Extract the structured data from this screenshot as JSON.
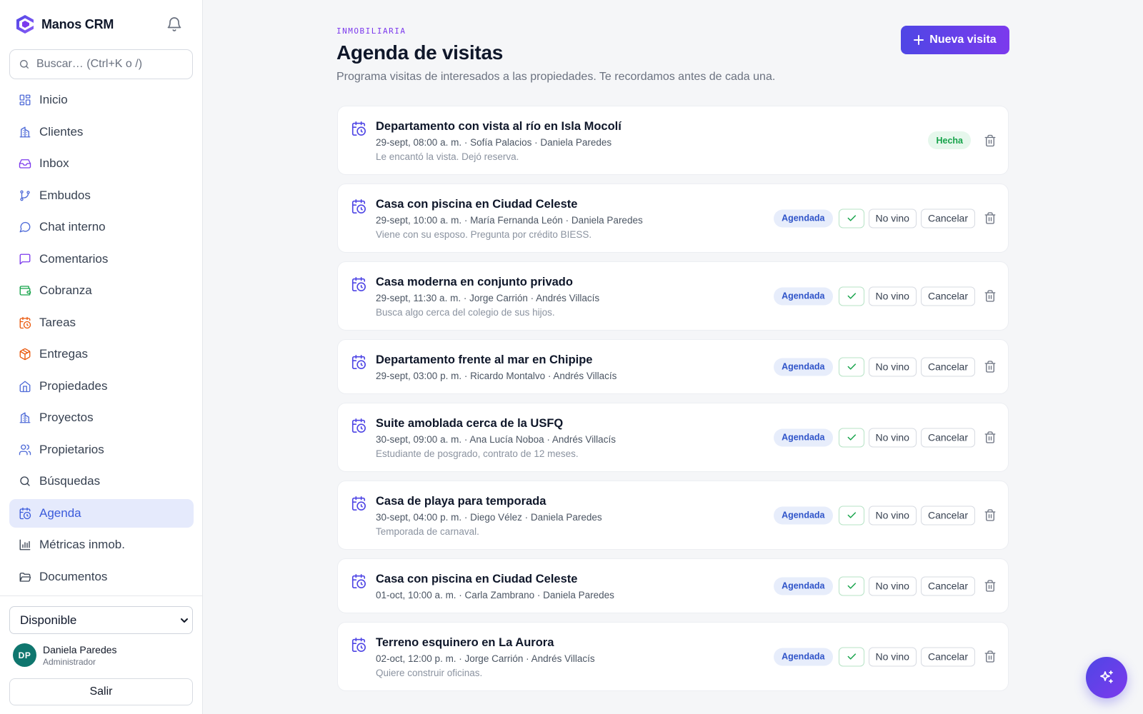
{
  "app": {
    "name": "Manos CRM"
  },
  "search": {
    "placeholder": "Buscar… (Ctrl+K o /)"
  },
  "sidebar": {
    "items": [
      {
        "label": "Inicio",
        "icon": "grid-icon",
        "color": "#4f6bd8"
      },
      {
        "label": "Clientes",
        "icon": "building-icon",
        "color": "#4f6bd8"
      },
      {
        "label": "Inbox",
        "icon": "inbox-icon",
        "color": "#7c3aed"
      },
      {
        "label": "Embudos",
        "icon": "git-branch-icon",
        "color": "#4f6bd8"
      },
      {
        "label": "Chat interno",
        "icon": "chat-bubble-icon",
        "color": "#4f6bd8"
      },
      {
        "label": "Comentarios",
        "icon": "comment-icon",
        "color": "#7c3aed"
      },
      {
        "label": "Cobranza",
        "icon": "wallet-icon",
        "color": "#16a34a"
      },
      {
        "label": "Tareas",
        "icon": "calendar-clock-icon",
        "color": "#ea580c"
      },
      {
        "label": "Entregas",
        "icon": "package-icon",
        "color": "#ea580c"
      },
      {
        "label": "Propiedades",
        "icon": "home-icon",
        "color": "#4f6bd8"
      },
      {
        "label": "Proyectos",
        "icon": "building-icon",
        "color": "#4f6bd8"
      },
      {
        "label": "Propietarios",
        "icon": "users-icon",
        "color": "#4f6bd8"
      },
      {
        "label": "Búsquedas",
        "icon": "search-icon",
        "color": "#374151"
      },
      {
        "label": "Agenda",
        "icon": "calendar-clock-icon",
        "color": "#3b5bdb",
        "active": true
      },
      {
        "label": "Métricas inmob.",
        "icon": "bar-chart-icon",
        "color": "#374151"
      },
      {
        "label": "Documentos",
        "icon": "folder-icon",
        "color": "#374151"
      }
    ]
  },
  "status": {
    "selected": "Disponible"
  },
  "user": {
    "initials": "DP",
    "name": "Daniela Paredes",
    "role": "Administrador"
  },
  "logout_label": "Salir",
  "header": {
    "eyebrow": "INMOBILIARIA",
    "title": "Agenda de visitas",
    "subtitle": "Programa visitas de interesados a las propiedades. Te recordamos antes de cada una.",
    "new_button": "Nueva visita"
  },
  "labels": {
    "scheduled": "Agendada",
    "done": "Hecha",
    "no_show": "No vino",
    "cancel": "Cancelar"
  },
  "visits": [
    {
      "title": "Departamento con vista al río en Isla Mocolí",
      "meta": "29-sept, 08:00 a. m. · Sofía Palacios · Daniela Paredes",
      "note": "Le encantó la vista. Dejó reserva.",
      "status": "done"
    },
    {
      "title": "Casa con piscina en Ciudad Celeste",
      "meta": "29-sept, 10:00 a. m. · María Fernanda León · Daniela Paredes",
      "note": "Viene con su esposo. Pregunta por crédito BIESS.",
      "status": "scheduled"
    },
    {
      "title": "Casa moderna en conjunto privado",
      "meta": "29-sept, 11:30 a. m. · Jorge Carrión · Andrés Villacís",
      "note": "Busca algo cerca del colegio de sus hijos.",
      "status": "scheduled"
    },
    {
      "title": "Departamento frente al mar en Chipipe",
      "meta": "29-sept, 03:00 p. m. · Ricardo Montalvo · Andrés Villacís",
      "note": "",
      "status": "scheduled"
    },
    {
      "title": "Suite amoblada cerca de la USFQ",
      "meta": "30-sept, 09:00 a. m. · Ana Lucía Noboa · Andrés Villacís",
      "note": "Estudiante de posgrado, contrato de 12 meses.",
      "status": "scheduled"
    },
    {
      "title": "Casa de playa para temporada",
      "meta": "30-sept, 04:00 p. m. · Diego Vélez · Daniela Paredes",
      "note": "Temporada de carnaval.",
      "status": "scheduled"
    },
    {
      "title": "Casa con piscina en Ciudad Celeste",
      "meta": "01-oct, 10:00 a. m. · Carla Zambrano · Daniela Paredes",
      "note": "",
      "status": "scheduled"
    },
    {
      "title": "Terreno esquinero en La Aurora",
      "meta": "02-oct, 12:00 p. m. · Jorge Carrión · Andrés Villacís",
      "note": "Quiere construir oficinas.",
      "status": "scheduled"
    }
  ],
  "colors": {
    "accent": "#4f46e5",
    "accent2": "#7c3aed",
    "done": "#16a34a",
    "scheduled": "#2f54c9"
  }
}
